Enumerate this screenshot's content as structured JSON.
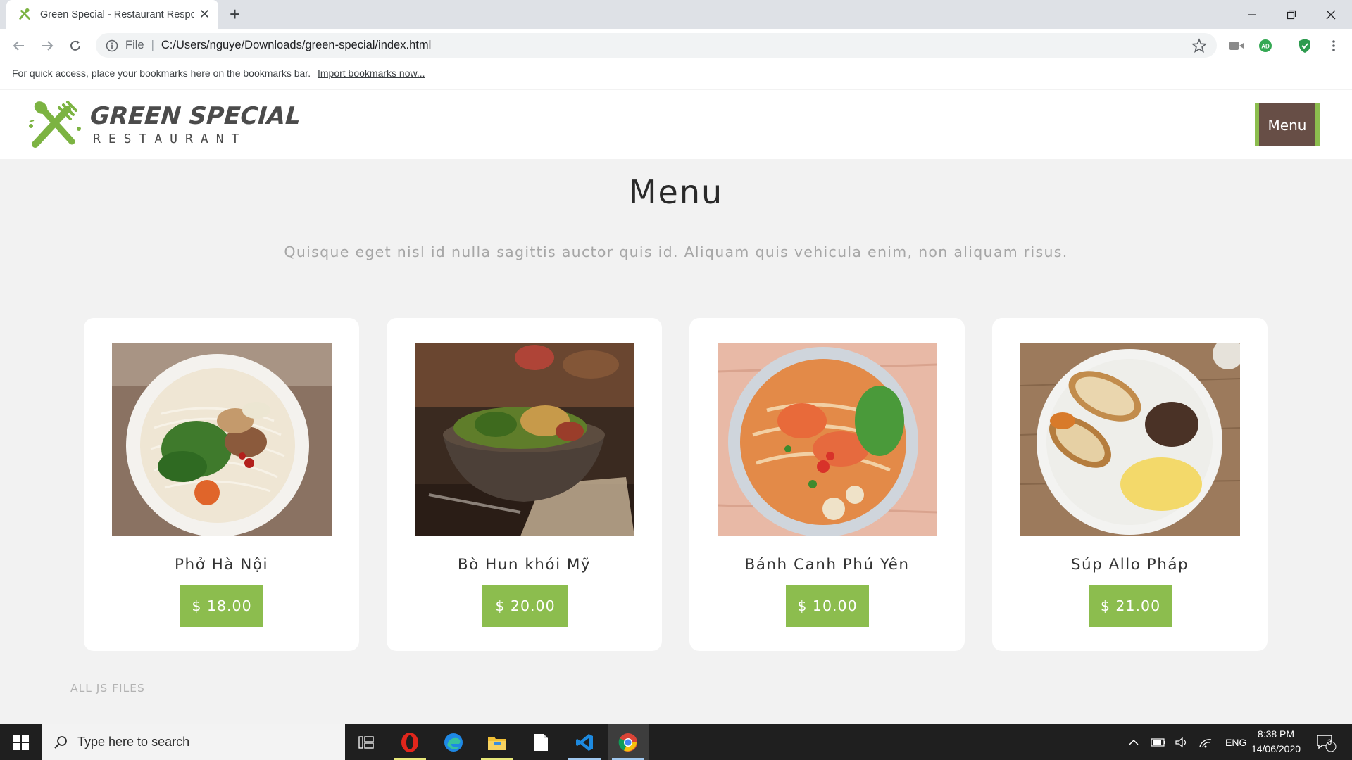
{
  "browser": {
    "tab_title": "Green Special - Restaurant Respo",
    "new_tab_label": "+",
    "url_scheme": "File",
    "url": "C:/Users/nguye/Downloads/green-special/index.html",
    "bookmarks_prompt": "For quick access, place your bookmarks here on the bookmarks bar.",
    "bookmarks_link": "Import bookmarks now..."
  },
  "site": {
    "logo_name": "GREEN SPECIAL",
    "logo_sub": "RESTAURANT",
    "menu_button": "Menu",
    "section_title": "Menu",
    "section_subtitle": "Quisque eget nisl id nulla sagittis auctor quis id. Aliquam quis vehicula enim, non aliquam risus.",
    "footer_note": "ALL JS FILES",
    "colors": {
      "accent_green": "#8cbd4e",
      "menu_brown": "#674e46",
      "title": "#2a2a2a",
      "muted": "#a6a6a6"
    }
  },
  "menu_items": [
    {
      "name": "Phở Hà Nội",
      "price": "$ 18.00",
      "image": "pho-bowl"
    },
    {
      "name": "Bò Hun khói Mỹ",
      "price": "$ 20.00",
      "image": "smoked-beef-bowl"
    },
    {
      "name": "Bánh Canh Phú Yên",
      "price": "$ 10.00",
      "image": "banh-canh-bowl"
    },
    {
      "name": "Súp Allo Pháp",
      "price": "$ 21.00",
      "image": "breakfast-plate"
    }
  ],
  "taskbar": {
    "search_placeholder": "Type here to search",
    "language": "ENG",
    "time": "8:38 PM",
    "date": "14/06/2020",
    "notification_count": "3"
  }
}
